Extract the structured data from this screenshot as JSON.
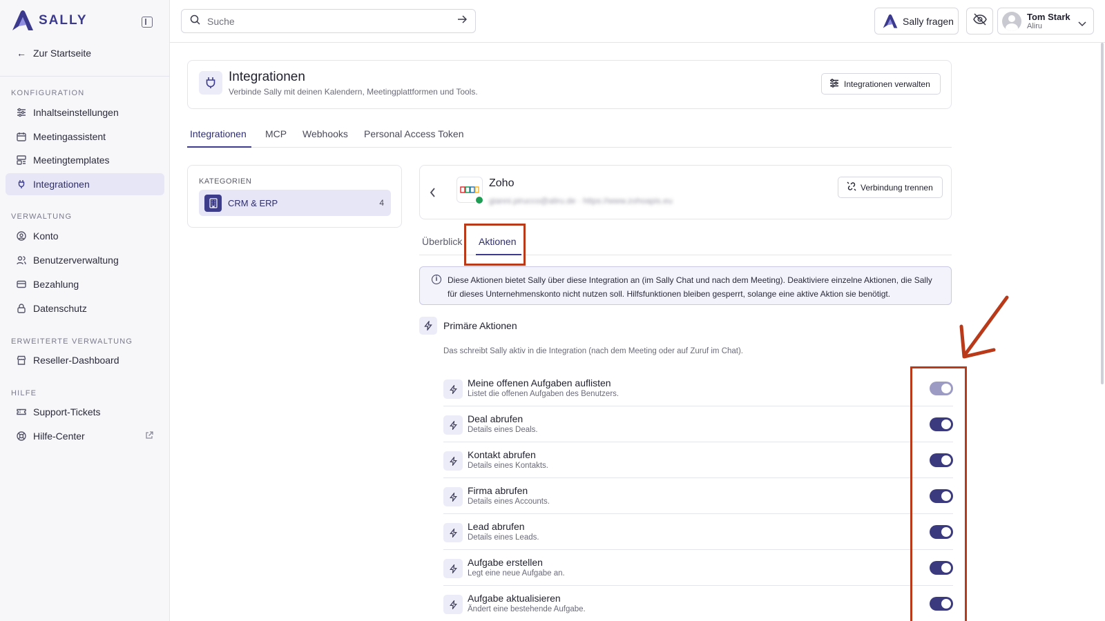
{
  "sidebar": {
    "logo_text": "SALLY",
    "back_label": "Zur Startseite",
    "sections": [
      {
        "label": "KONFIGURATION"
      },
      {
        "label": "VERWALTUNG"
      },
      {
        "label": "ERWEITERTE VERWALTUNG"
      },
      {
        "label": "HILFE"
      }
    ],
    "items": [
      {
        "label": "Inhaltseinstellungen",
        "icon": "sliders-icon"
      },
      {
        "label": "Meetingassistent",
        "icon": "calendar-icon"
      },
      {
        "label": "Meetingtemplates",
        "icon": "template-icon"
      },
      {
        "label": "Integrationen",
        "icon": "plug-icon",
        "active": true
      },
      {
        "label": "Konto",
        "icon": "user-circle-icon"
      },
      {
        "label": "Benutzerverwaltung",
        "icon": "users-icon"
      },
      {
        "label": "Bezahlung",
        "icon": "credit-card-icon"
      },
      {
        "label": "Datenschutz",
        "icon": "lock-icon"
      },
      {
        "label": "Reseller-Dashboard",
        "icon": "store-icon"
      },
      {
        "label": "Support-Tickets",
        "icon": "ticket-icon"
      },
      {
        "label": "Hilfe-Center",
        "icon": "lifebuoy-icon"
      }
    ]
  },
  "topbar": {
    "search_placeholder": "Suche",
    "ask_sally_label": "Sally fragen",
    "user_name": "Tom Stark",
    "user_org": "Aliru"
  },
  "header": {
    "title": "Integrationen",
    "subtitle": "Verbinde Sally mit deinen Kalendern, Meetingplattformen und Tools.",
    "manage_label": "Integrationen verwalten"
  },
  "main_tabs": [
    "Integrationen",
    "MCP",
    "Webhooks",
    "Personal Access Token"
  ],
  "categories": {
    "label": "KATEGORIEN",
    "items": [
      {
        "label": "CRM & ERP",
        "count": "4"
      }
    ]
  },
  "integration": {
    "name": "Zoho",
    "account": "gianni.pirucco@aliru.de · https://www.zohoapis.eu",
    "disconnect_label": "Verbindung trennen",
    "tabs": [
      "Überblick",
      "Aktionen"
    ],
    "active_tab": "Aktionen",
    "info_text": "Diese Aktionen bietet Sally über diese Integration an (im Sally Chat und nach dem Meeting). Deaktiviere einzelne Aktionen, die Sally für dieses Unternehmenskonto nicht nutzen soll. Hilfsfunktionen bleiben gesperrt, solange eine aktive Aktion sie benötigt.",
    "primary_title": "Primäre Aktionen",
    "primary_desc": "Das schreibt Sally aktiv in die Integration (nach dem Meeting oder auf Zuruf im Chat).",
    "actions": [
      {
        "title": "Meine offenen Aufgaben auflisten",
        "desc": "Listet die offenen Aufgaben des Benutzers.",
        "enabled": true,
        "dimmed": true
      },
      {
        "title": "Deal abrufen",
        "desc": "Details eines Deals.",
        "enabled": true
      },
      {
        "title": "Kontakt abrufen",
        "desc": "Details eines Kontakts.",
        "enabled": true
      },
      {
        "title": "Firma abrufen",
        "desc": "Details eines Accounts.",
        "enabled": true
      },
      {
        "title": "Lead abrufen",
        "desc": "Details eines Leads.",
        "enabled": true
      },
      {
        "title": "Aufgabe erstellen",
        "desc": "Legt eine neue Aufgabe an.",
        "enabled": true
      },
      {
        "title": "Aufgabe aktualisieren",
        "desc": "Ändert eine bestehende Aufgabe.",
        "enabled": true
      }
    ]
  },
  "colors": {
    "accent": "#3b3a7e",
    "annotation": "#b83a1a"
  }
}
